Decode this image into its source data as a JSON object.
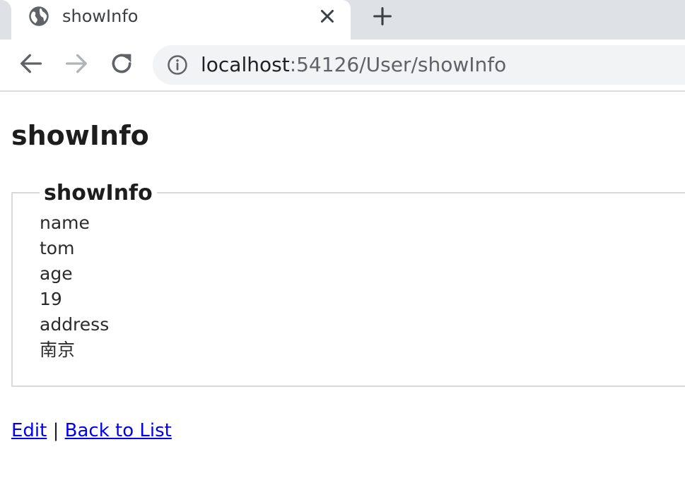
{
  "browser": {
    "tab_title": "showInfo",
    "url_host": "localhost",
    "url_rest": ":54126/User/showInfo"
  },
  "page": {
    "heading": "showInfo",
    "legend": "showInfo",
    "fields": [
      {
        "label": "name",
        "value": "tom"
      },
      {
        "label": "age",
        "value": "19"
      },
      {
        "label": "address",
        "value": "南京"
      }
    ],
    "links": {
      "edit": "Edit",
      "separator": "|",
      "back": "Back to List"
    }
  },
  "icons": {
    "favicon": "globe-icon",
    "close": "close-icon",
    "new_tab": "plus-icon",
    "back": "arrow-left-icon",
    "forward": "arrow-right-icon",
    "reload": "reload-icon",
    "info": "info-icon"
  },
  "colors": {
    "tabstrip": "#dee1e6",
    "omnibox": "#f1f3f4",
    "link": "#0000ee",
    "forward_disabled": "#b0b3b8"
  }
}
